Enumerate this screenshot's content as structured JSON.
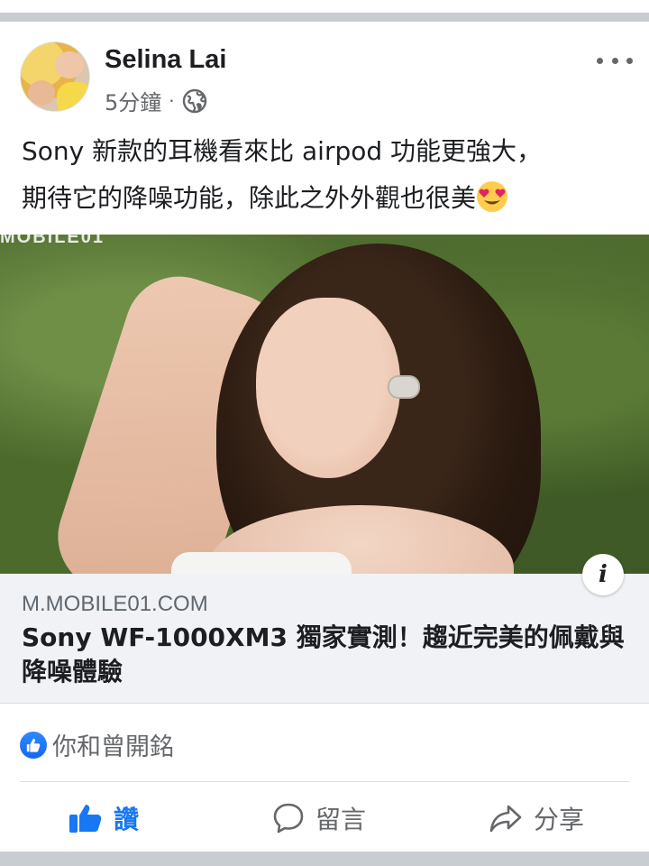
{
  "post": {
    "author": "Selina Lai",
    "time": "5分鐘",
    "separator": "·",
    "text_line1": "Sony 新款的耳機看來比 airpod 功能更強大，",
    "text_line2": "期待它的降噪功能，除此之外外觀也很美"
  },
  "image": {
    "watermark": "MOBILE01"
  },
  "link": {
    "domain": "M.MOBILE01.COM",
    "title": "Sony WF-1000XM3 獨家實測！趨近完美的佩戴與降噪體驗",
    "info_label": "i"
  },
  "reactions": {
    "text": "你和曾開銘"
  },
  "actions": {
    "like": "讚",
    "comment": "留言",
    "share": "分享"
  },
  "colors": {
    "accent": "#1877f2",
    "secondary_text": "#65676b",
    "separator": "#c9ccd1",
    "link_bg": "#f0f2f5"
  },
  "icons": {
    "more": "more-dots-icon",
    "privacy": "globe-icon",
    "emoji": "heart-eyes-emoji-icon",
    "info": "info-icon",
    "reaction": "like-reaction-icon",
    "like": "thumbs-up-icon",
    "comment": "comment-bubble-icon",
    "share": "share-arrow-icon"
  }
}
